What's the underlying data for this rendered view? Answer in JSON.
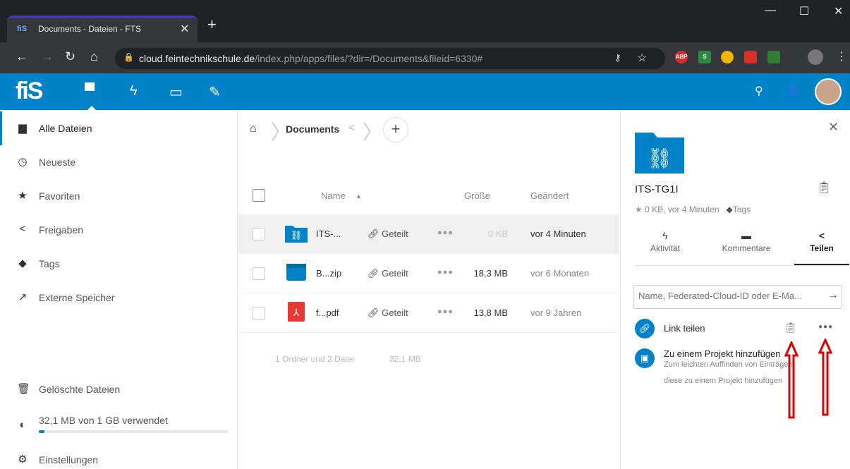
{
  "browser": {
    "tab_title": "Documents - Dateien - FTS",
    "url_domain": "cloud.feintechnikschule.de",
    "url_path": "/index.php/apps/files/?dir=/Documents&fileid=6330#",
    "ext_abp": "ABP"
  },
  "app": {
    "logo": "fiS",
    "accent": "#0082c9"
  },
  "sidebar": {
    "items": [
      {
        "label": "Alle Dateien",
        "icon": "folder-icon"
      },
      {
        "label": "Neueste",
        "icon": "clock-icon"
      },
      {
        "label": "Favoriten",
        "icon": "star-icon"
      },
      {
        "label": "Freigaben",
        "icon": "share-icon"
      },
      {
        "label": "Tags",
        "icon": "tag-icon"
      },
      {
        "label": "Externe Speicher",
        "icon": "external-icon"
      }
    ],
    "trash": "Gelöschte Dateien",
    "quota": "32,1 MB von 1 GB verwendet",
    "quota_fraction": 0.03,
    "settings": "Einstellungen"
  },
  "breadcrumb": {
    "folder": "Documents"
  },
  "table": {
    "headers": {
      "name": "Name",
      "sort": "▲",
      "size": "Größe",
      "modified": "Geändert"
    },
    "rows": [
      {
        "name": "ITS-...",
        "share": "Geteilt",
        "size": "0 KB",
        "modified": "vor 4 Minuten",
        "type": "shared-folder"
      },
      {
        "name": "B...zip",
        "share": "Geteilt",
        "size": "18,3 MB",
        "modified": "vor 6 Monaten",
        "type": "archive"
      },
      {
        "name": "f...pdf",
        "share": "Geteilt",
        "size": "13,8 MB",
        "modified": "vor 9 Jahren",
        "type": "pdf"
      }
    ],
    "summary_count": "1 Ordner und 2 Datei",
    "summary_size": "32,1 MB"
  },
  "panel": {
    "title": "ITS-TG1I",
    "meta": "0 KB, vor 4 Minuten",
    "tags": "Tags",
    "tabs": [
      "Aktivität",
      "Kommentare",
      "Teilen"
    ],
    "search_placeholder": "Name, Federated-Cloud-ID oder E-Ma...",
    "link_share": "Link teilen",
    "project_title": "Zu einem Projekt hinzufügen",
    "project_sub1": "Zum leichten Auffinden von Einträgen,",
    "project_sub2": "diese zu einem Projekt hinzufügen"
  }
}
